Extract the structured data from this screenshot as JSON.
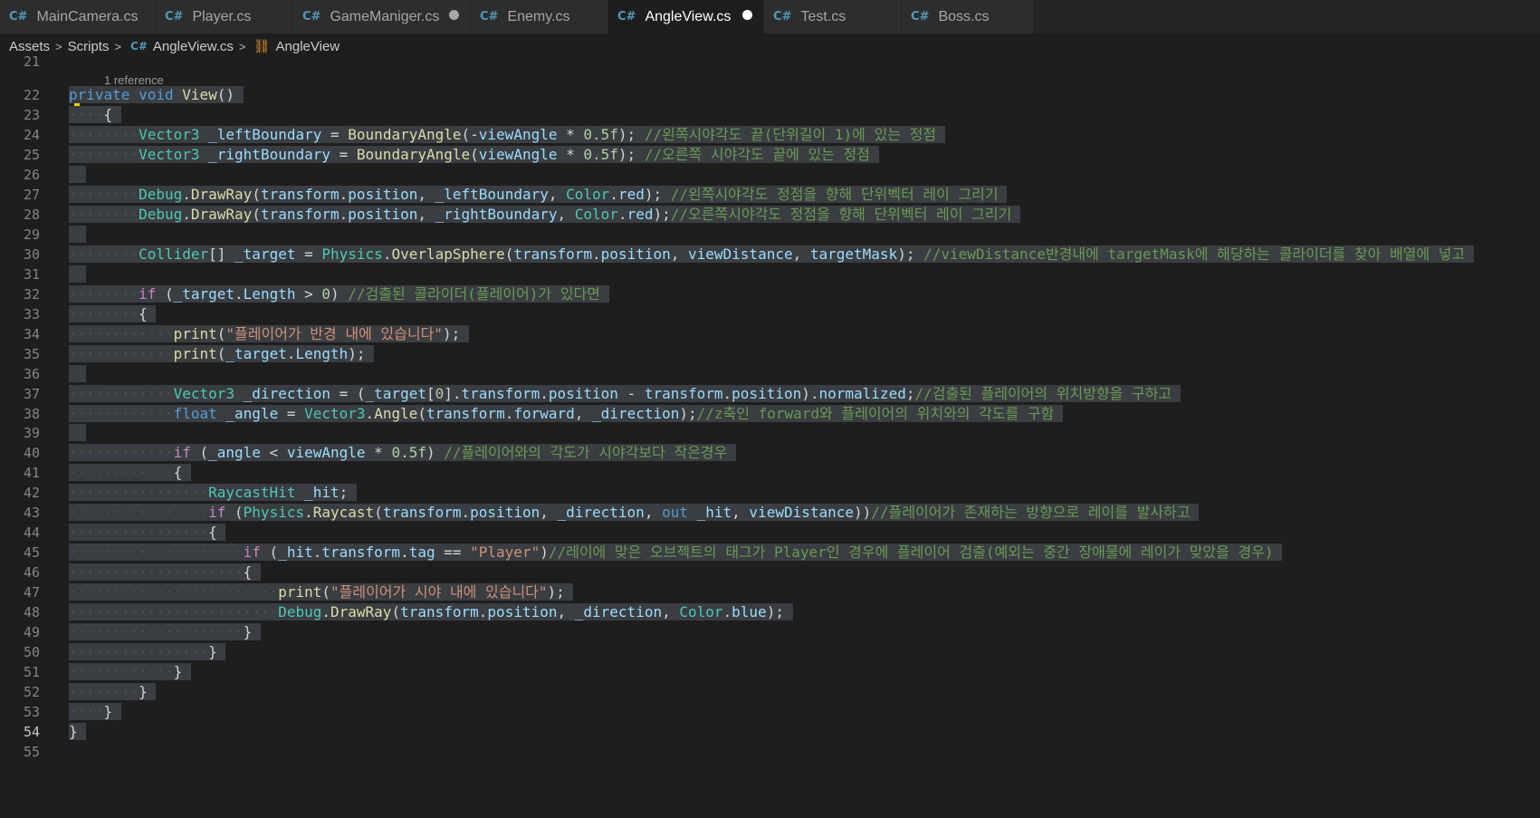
{
  "tabs": [
    {
      "label": "MainCamera.cs",
      "icon": "csharp-icon",
      "active": false,
      "dirty": false,
      "width": 172
    },
    {
      "label": "Player.cs",
      "icon": "csharp-icon",
      "active": false,
      "dirty": false,
      "width": 152
    },
    {
      "label": "GameManiger.cs",
      "icon": "csharp-icon",
      "active": false,
      "dirty": true,
      "width": 196
    },
    {
      "label": "Enemy.cs",
      "icon": "csharp-icon",
      "active": false,
      "dirty": false,
      "width": 152
    },
    {
      "label": "AngleView.cs",
      "icon": "csharp-icon",
      "active": true,
      "dirty": true,
      "width": 172
    },
    {
      "label": "Test.cs",
      "icon": "csharp-icon",
      "active": false,
      "dirty": false,
      "width": 152
    },
    {
      "label": "Boss.cs",
      "icon": "csharp-icon",
      "active": false,
      "dirty": false,
      "width": 146
    }
  ],
  "breadcrumb": {
    "assets": "Assets",
    "scripts": "Scripts",
    "file": "AngleView.cs",
    "class": "AngleView"
  },
  "codelens": "1 reference",
  "colors": {
    "editor_bg": "#1e1e1e",
    "selection": "#3a3d41",
    "keyword": "#569cd6",
    "type": "#4ec9b0",
    "comment": "#6a9955",
    "string": "#ce9178"
  },
  "lines": [
    {
      "n": "21",
      "code": ""
    },
    {
      "n": "22",
      "code": "private void View()"
    },
    {
      "n": "23",
      "code": "    {"
    },
    {
      "n": "24",
      "code": "        Vector3 _leftBoundary = BoundaryAngle(-viewAngle * 0.5f); //왼쪽시야각도 끝(단위길이 1)에 있는 정점"
    },
    {
      "n": "25",
      "code": "        Vector3 _rightBoundary = BoundaryAngle(viewAngle * 0.5f); //오른쪽 시야각도 끝에 있는 정점"
    },
    {
      "n": "26",
      "code": ""
    },
    {
      "n": "27",
      "code": "        Debug.DrawRay(transform.position, _leftBoundary, Color.red); //왼쪽시야각도 정점을 향해 단위벡터 레이 그리기"
    },
    {
      "n": "28",
      "code": "        Debug.DrawRay(transform.position, _rightBoundary, Color.red);//오른쪽시야각도 정점을 향해 단위벡터 레이 그리기"
    },
    {
      "n": "29",
      "code": ""
    },
    {
      "n": "30",
      "code": "        Collider[] _target = Physics.OverlapSphere(transform.position, viewDistance, targetMask); //viewDistance반경내에 targetMask에 해당하는 콜라이더를 찾아 배열에 넣고"
    },
    {
      "n": "31",
      "code": ""
    },
    {
      "n": "32",
      "code": "        if (_target.Length > 0) //검출된 콜라이더(플레이어)가 있다면"
    },
    {
      "n": "33",
      "code": "        {"
    },
    {
      "n": "34",
      "code": "            print(\"플레이어가 반경 내에 있습니다\");"
    },
    {
      "n": "35",
      "code": "            print(_target.Length);"
    },
    {
      "n": "36",
      "code": ""
    },
    {
      "n": "37",
      "code": "            Vector3 _direction = (_target[0].transform.position - transform.position).normalized;//검출된 플레이어의 위치방향을 구하고"
    },
    {
      "n": "38",
      "code": "            float _angle = Vector3.Angle(transform.forward, _direction);//z축인 forward와 플레이어의 위치와의 각도를 구함"
    },
    {
      "n": "39",
      "code": ""
    },
    {
      "n": "40",
      "code": "            if (_angle < viewAngle * 0.5f) //플레이어와의 각도가 시야각보다 작은경우"
    },
    {
      "n": "41",
      "code": "            {"
    },
    {
      "n": "42",
      "code": "                RaycastHit _hit;"
    },
    {
      "n": "43",
      "code": "                if (Physics.Raycast(transform.position, _direction, out _hit, viewDistance))//플레이어가 존재하는 방향으로 레이를 발사하고"
    },
    {
      "n": "44",
      "code": "                {"
    },
    {
      "n": "45",
      "code": "                    if (_hit.transform.tag == \"Player\")//레이에 맞은 오브젝트의 태그가 Player인 경우에 플레이어 검출(예외는 중간 장애물에 레이가 맞았을 경우)"
    },
    {
      "n": "46",
      "code": "                    {"
    },
    {
      "n": "47",
      "code": "                        print(\"플레이어가 시야 내에 있습니다\");"
    },
    {
      "n": "48",
      "code": "                        Debug.DrawRay(transform.position, _direction, Color.blue);"
    },
    {
      "n": "49",
      "code": "                    }"
    },
    {
      "n": "50",
      "code": "                }"
    },
    {
      "n": "51",
      "code": "            }"
    },
    {
      "n": "52",
      "code": "        }"
    },
    {
      "n": "53",
      "code": "    }"
    },
    {
      "n": "54",
      "code": "}"
    },
    {
      "n": "55",
      "code": ""
    }
  ]
}
